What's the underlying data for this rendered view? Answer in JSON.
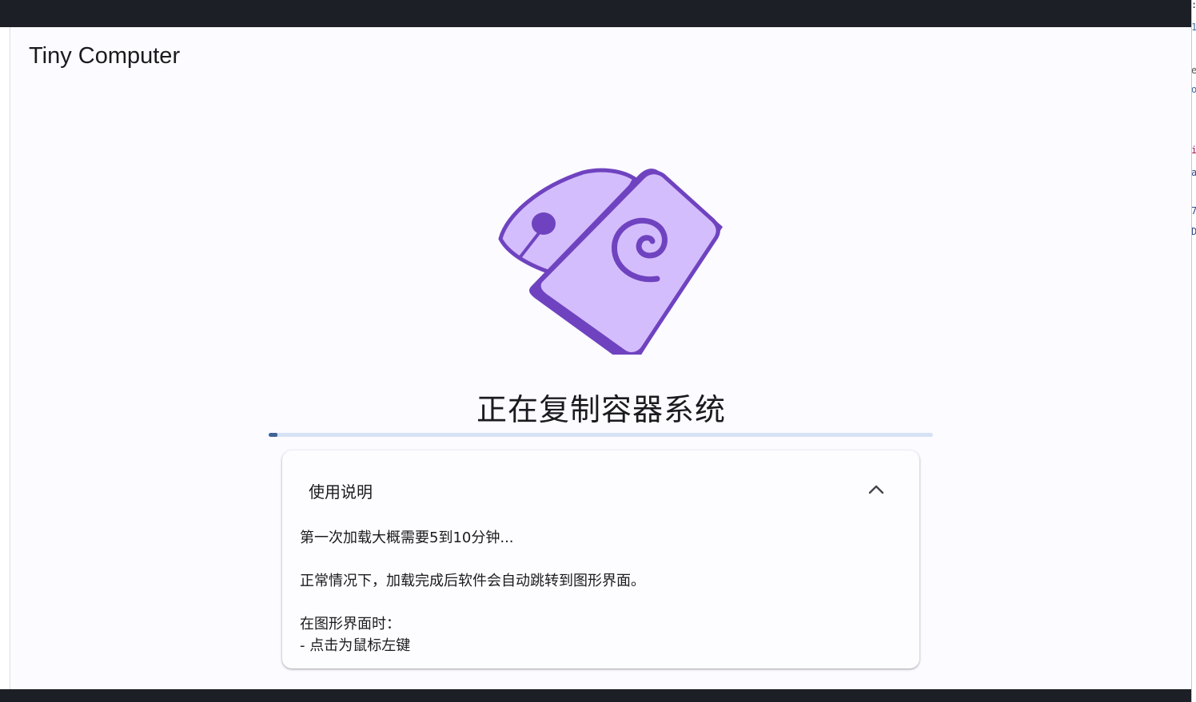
{
  "window": {
    "title": "Tiny Computer"
  },
  "status": {
    "title": "正在复制容器系统",
    "progress": 0.013
  },
  "instructions": {
    "title": "使用说明",
    "expanded": true,
    "toggle_icon": "chevron-up-icon",
    "lines": [
      "第一次加载大概需要5到10分钟...",
      "",
      "正常情况下，加载完成后软件会自动跳转到图形界面。",
      "",
      "在图形界面时：",
      "- 点击为鼠标左键"
    ]
  },
  "logo": {
    "icon": "phone-mouse-debian-logo",
    "colors": {
      "fill": "#d4bdfc",
      "stroke": "#6f43c0"
    }
  },
  "colors": {
    "chrome": "#1c1f26",
    "background": "#fcfbff",
    "progress_track": "#d6e2f5",
    "progress_fill": "#3f6496"
  }
}
